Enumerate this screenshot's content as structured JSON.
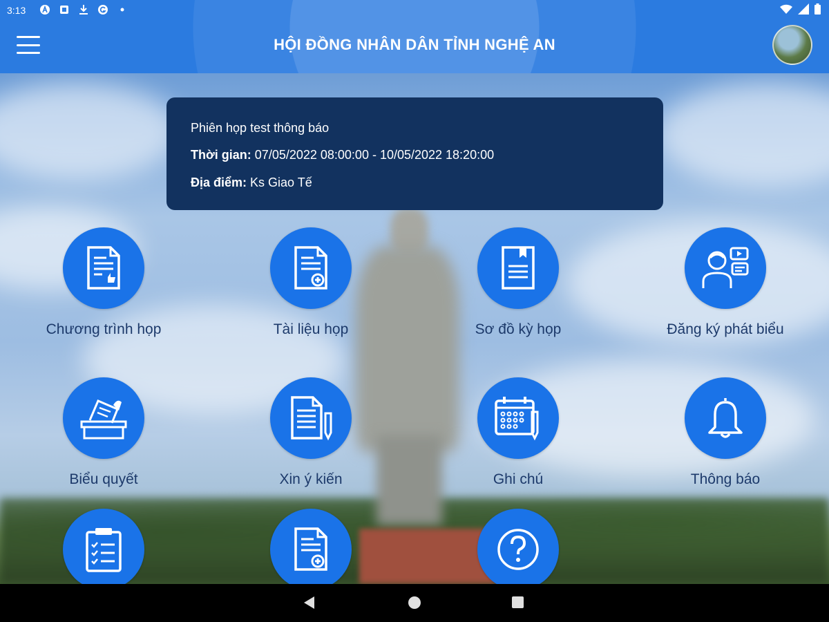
{
  "status_bar": {
    "time": "3:13",
    "icons": [
      "notification-a-icon",
      "notification-box-icon",
      "download-icon",
      "notification-g-icon",
      "dot-icon"
    ],
    "system_icons": [
      "wifi-icon",
      "signal-icon",
      "battery-icon"
    ]
  },
  "header": {
    "title": "HỘI ĐỒNG NHÂN DÂN TỈNH NGHỆ AN",
    "menu_icon": "menu-icon",
    "avatar_icon": "avatar"
  },
  "meeting_card": {
    "name": "Phiên họp test thông báo",
    "time_label": "Thời gian:",
    "time_value": " 07/05/2022 08:00:00 - 10/05/2022 18:20:00",
    "location_label": "Địa điểm:",
    "location_value": " Ks Giao Tế"
  },
  "features": [
    {
      "label": "Chương trình họp",
      "icon": "program-document-icon"
    },
    {
      "label": "Tài liệu họp",
      "icon": "document-add-icon"
    },
    {
      "label": "Sơ đồ kỳ họp",
      "icon": "bookmark-document-icon"
    },
    {
      "label": "Đăng ký phát biểu",
      "icon": "speaker-register-icon"
    },
    {
      "label": "Biểu quyết",
      "icon": "vote-box-icon"
    },
    {
      "label": "Xin ý kiến",
      "icon": "document-pen-icon"
    },
    {
      "label": "Ghi chú",
      "icon": "calendar-note-icon"
    },
    {
      "label": "Thông báo",
      "icon": "bell-icon"
    },
    {
      "label": "",
      "icon": "clipboard-list-icon"
    },
    {
      "label": "",
      "icon": "document-add-icon"
    },
    {
      "label": "",
      "icon": "help-icon"
    }
  ],
  "colors": {
    "header_blue": "#2b7be0",
    "card_navy": "#12325f",
    "icon_circle": "#1a73e8",
    "label_text": "#1d3a6b"
  }
}
